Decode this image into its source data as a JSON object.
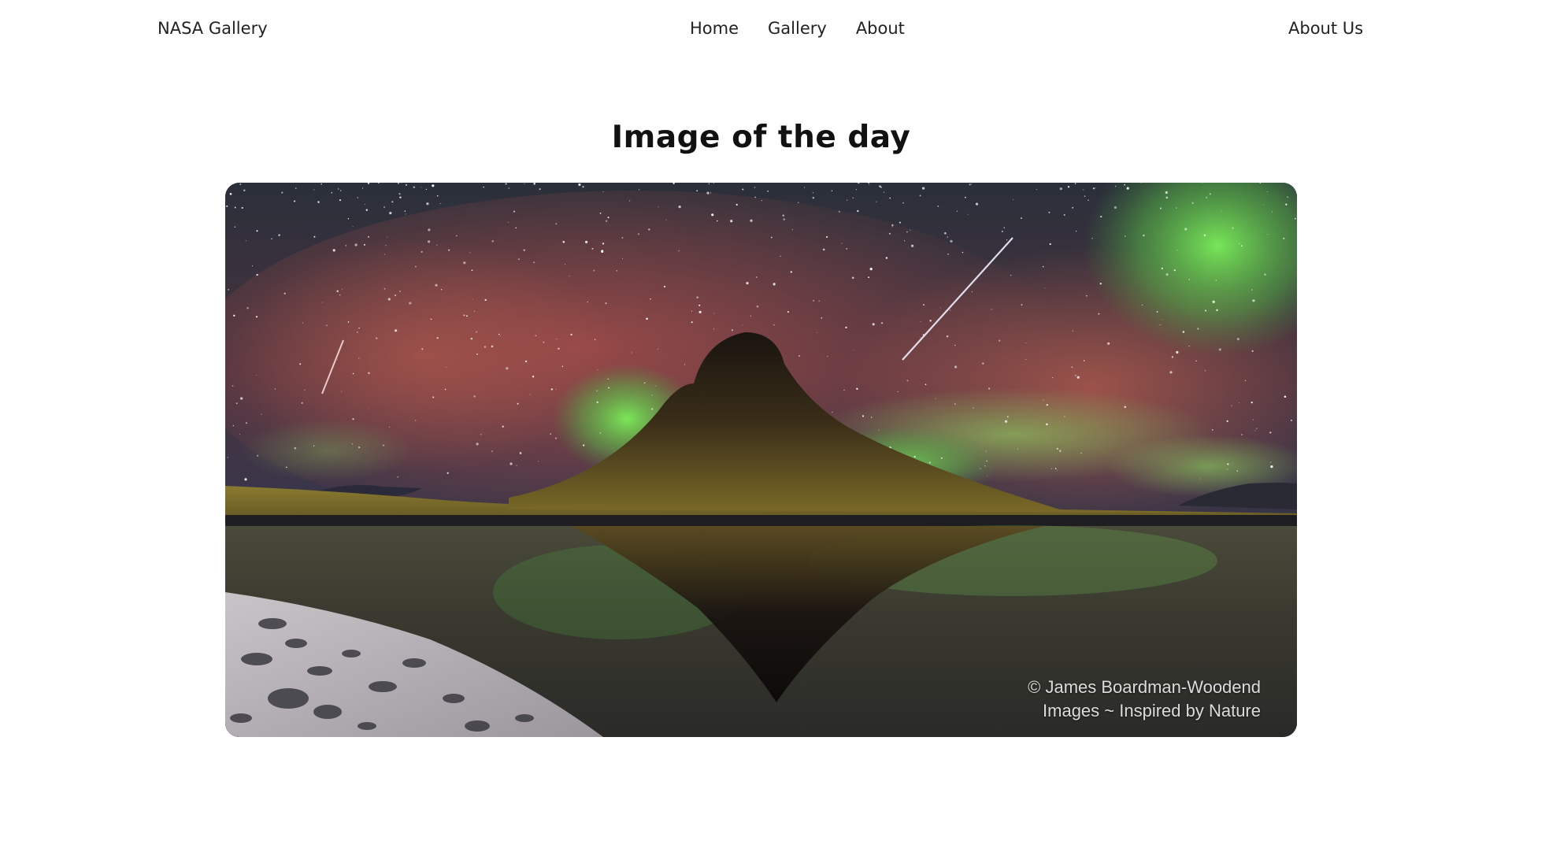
{
  "header": {
    "brand": "NASA Gallery",
    "nav": [
      "Home",
      "Gallery",
      "About"
    ],
    "right_link": "About Us"
  },
  "main": {
    "title": "Image of the day",
    "image": {
      "subject": "aurora-over-mountain-photo",
      "credit_line1": "© James Boardman-Woodend",
      "credit_line2": "Images ~ Inspired by Nature"
    }
  }
}
